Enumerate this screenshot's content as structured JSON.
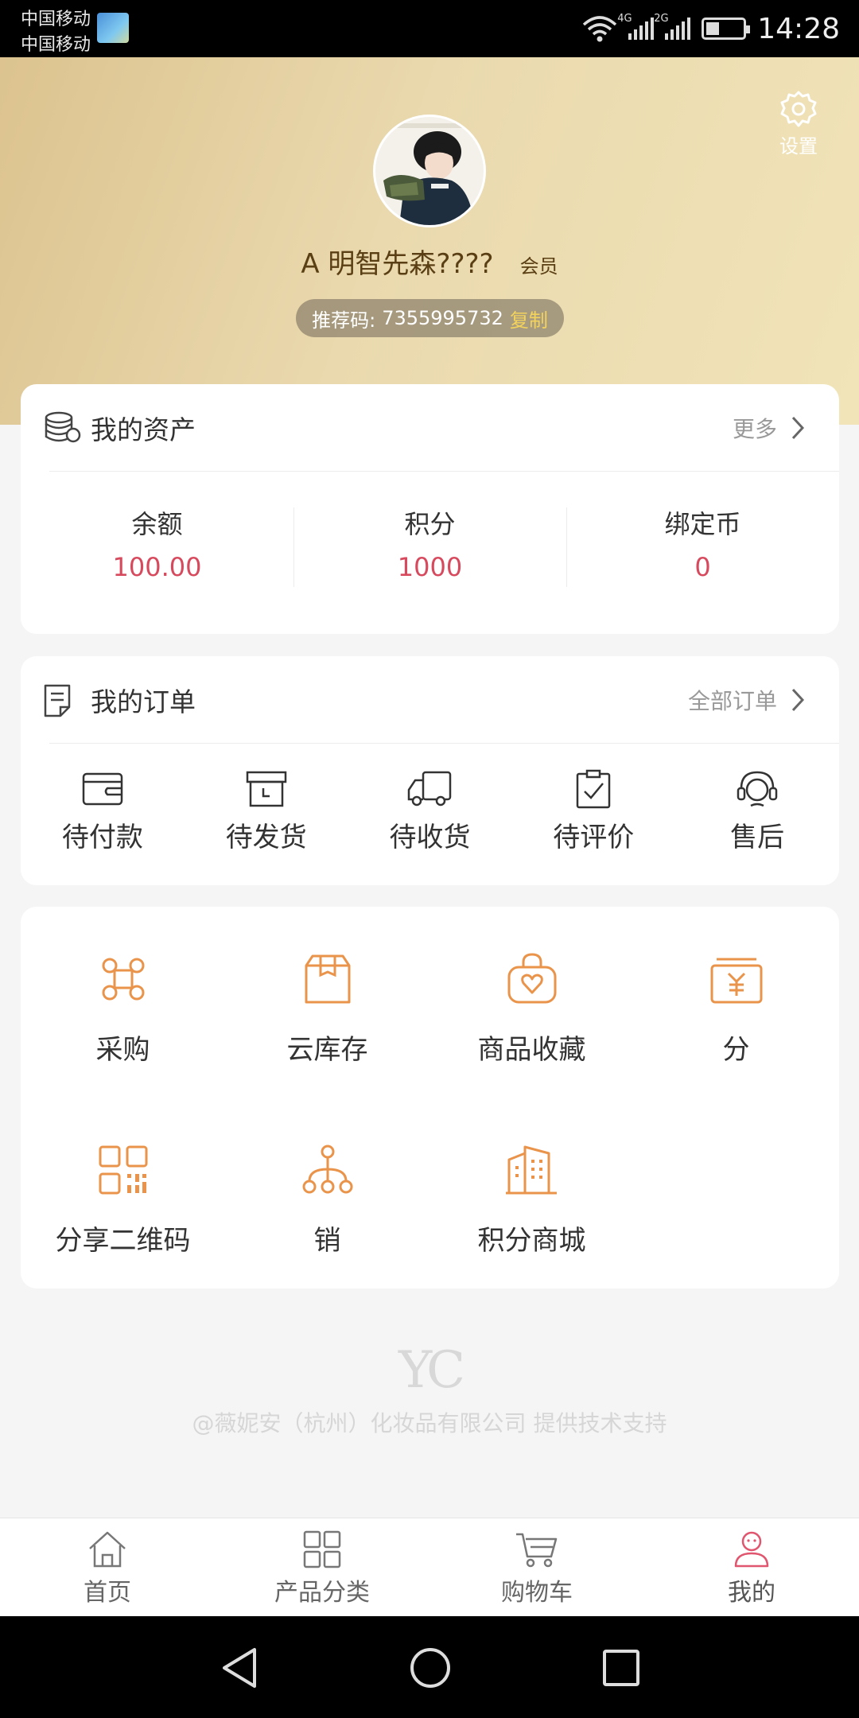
{
  "status_bar": {
    "carrier_1": "中国移动",
    "carrier_2": "中国移动",
    "time": "14:28",
    "network_1": "4G",
    "network_2": "2G"
  },
  "header": {
    "settings_label": "设置",
    "username": "A 明智先森????",
    "member_label": "会员",
    "referral_label": "推荐码:",
    "referral_code": "7355995732",
    "copy_label": "复制"
  },
  "assets": {
    "title": "我的资产",
    "more": "更多",
    "items": [
      {
        "label": "余额",
        "value": "100.00"
      },
      {
        "label": "积分",
        "value": "1000"
      },
      {
        "label": "绑定币",
        "value": "0"
      }
    ]
  },
  "orders": {
    "title": "我的订单",
    "all_orders": "全部订单",
    "items": [
      {
        "label": "待付款",
        "icon": "wallet-icon"
      },
      {
        "label": "待发货",
        "icon": "box-icon"
      },
      {
        "label": "待收货",
        "icon": "truck-icon"
      },
      {
        "label": "待评价",
        "icon": "checklist-icon"
      },
      {
        "label": "售后",
        "icon": "headset-icon"
      }
    ]
  },
  "tools": {
    "items": [
      {
        "label": "采购",
        "icon": "purchase-icon"
      },
      {
        "label": "云库存",
        "icon": "cloud-stock-icon"
      },
      {
        "label": "商品收藏",
        "icon": "favorite-bag-icon"
      },
      {
        "label": "分",
        "icon": "yuan-box-icon"
      },
      {
        "label": "分享二维码",
        "icon": "qrcode-icon"
      },
      {
        "label": "销",
        "icon": "network-icon"
      },
      {
        "label": "积分商城",
        "icon": "building-icon"
      }
    ]
  },
  "footer": {
    "logo_text": "YC",
    "support_text": "@薇妮安（杭州）化妆品有限公司 提供技术支持"
  },
  "tabbar": {
    "items": [
      {
        "label": "首页",
        "icon": "home-icon"
      },
      {
        "label": "产品分类",
        "icon": "grid-icon"
      },
      {
        "label": "购物车",
        "icon": "cart-icon"
      },
      {
        "label": "我的",
        "icon": "user-icon"
      }
    ],
    "active_index": 3
  },
  "colors": {
    "accent_orange": "#e9944a",
    "value_red": "#d74a5e",
    "active_pink": "#e0566e",
    "header_gold": "#dcc38f"
  }
}
